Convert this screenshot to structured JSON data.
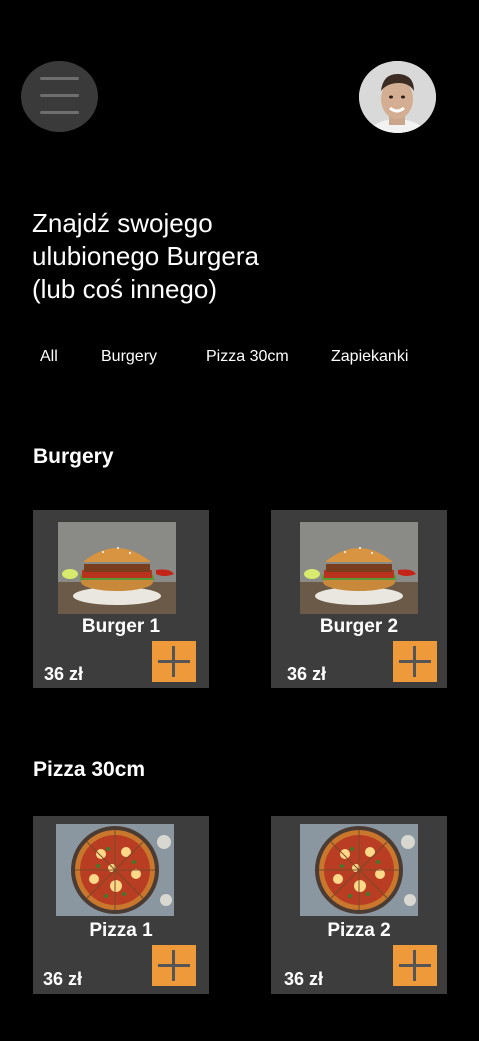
{
  "header": {
    "menu_icon": "hamburger-menu-icon",
    "avatar_icon": "user-avatar-photo"
  },
  "headline": {
    "line1": "Znajdź swojego",
    "line2": "ulubionego Burgera",
    "line3": "(lub coś innego)"
  },
  "tabs": [
    "All",
    "Burgery",
    "Pizza 30cm",
    "Zapiekanki"
  ],
  "sections": [
    {
      "title": "Burgery",
      "items": [
        {
          "name": "Burger 1",
          "price": "36 zł"
        },
        {
          "name": "Burger 2",
          "price": "36 zł"
        }
      ]
    },
    {
      "title": "Pizza 30cm",
      "items": [
        {
          "name": "Pizza 1",
          "price": "36 zł"
        },
        {
          "name": "Pizza 2",
          "price": "36 zł"
        }
      ]
    }
  ],
  "colors": {
    "background": "#000000",
    "card": "#3d3d3d",
    "accent": "#ef9a3a",
    "menu_button": "#3a3a3a"
  },
  "icons": {
    "add": "plus-icon"
  }
}
